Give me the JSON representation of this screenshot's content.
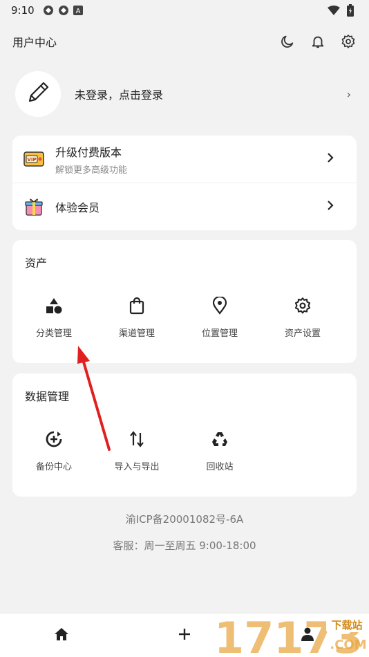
{
  "status_bar": {
    "time": "9:10",
    "icons": [
      "sync-icon",
      "sync-icon",
      "a-icon",
      "wifi-icon",
      "battery-icon"
    ]
  },
  "header": {
    "title": "用户中心",
    "icons": [
      "moon-icon",
      "bell-icon",
      "gear-icon"
    ]
  },
  "login": {
    "text": "未登录，点击登录",
    "icon": "pen-icon",
    "chevron": "›"
  },
  "upgrade_card": {
    "items": [
      {
        "title": "升级付费版本",
        "subtitle": "解锁更多高级功能",
        "icon": "vip-ticket-icon"
      },
      {
        "title": "体验会员",
        "icon": "gift-icon"
      }
    ]
  },
  "assets": {
    "title": "资产",
    "items": [
      {
        "label": "分类管理",
        "icon": "shapes-icon"
      },
      {
        "label": "渠道管理",
        "icon": "bag-icon"
      },
      {
        "label": "位置管理",
        "icon": "location-pin-icon"
      },
      {
        "label": "资产设置",
        "icon": "gear-icon"
      }
    ]
  },
  "data_mgmt": {
    "title": "数据管理",
    "items": [
      {
        "label": "备份中心",
        "icon": "backup-icon"
      },
      {
        "label": "导入与导出",
        "icon": "swap-vertical-icon"
      },
      {
        "label": "回收站",
        "icon": "recycle-icon"
      }
    ]
  },
  "footer": {
    "icp": "渝ICP备20001082号-6A",
    "service": "客服：周一至周五 9:00-18:00"
  },
  "bottom_nav": {
    "icons": [
      "home-icon",
      "plus-icon",
      "person-icon"
    ]
  },
  "watermark": {
    "number": "17173",
    "tag": "下载站",
    "domain": ".COM"
  },
  "colors": {
    "background": "#f2f2f2",
    "card": "#ffffff",
    "annotation_arrow": "#e02020",
    "watermark": "#e8a33a"
  }
}
